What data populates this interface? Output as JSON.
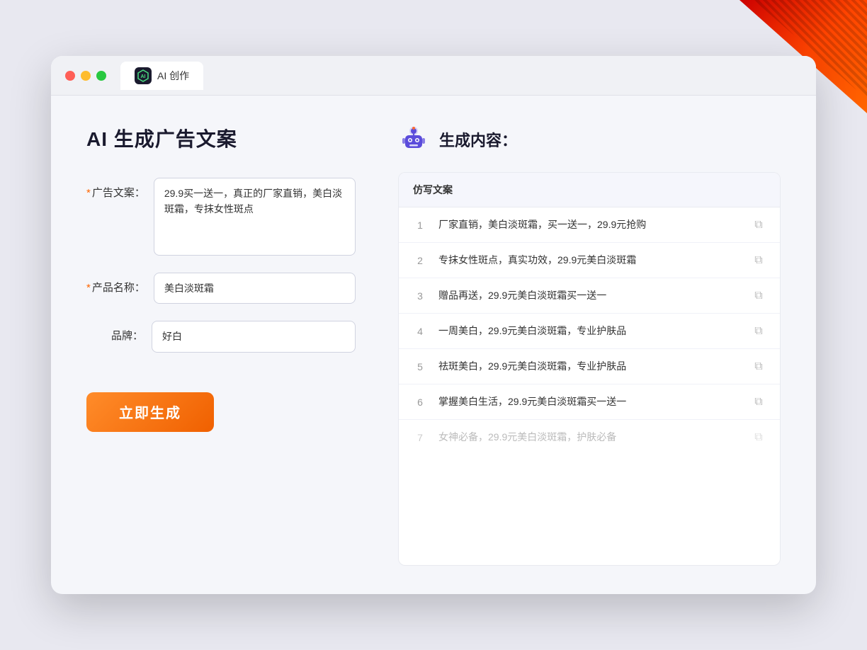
{
  "window": {
    "tab_icon": "AI",
    "tab_label": "AI 创作"
  },
  "left": {
    "title": "AI 生成广告文案",
    "fields": [
      {
        "label": "广告文案：",
        "required": true,
        "name": "ad_copy",
        "type": "textarea",
        "value": "29.9买一送一，真正的厂家直销，美白淡斑霜，专抹女性斑点"
      },
      {
        "label": "产品名称：",
        "required": true,
        "name": "product_name",
        "type": "input",
        "value": "美白淡斑霜"
      },
      {
        "label": "品牌：",
        "required": false,
        "name": "brand",
        "type": "input",
        "value": "好白"
      }
    ],
    "button_label": "立即生成"
  },
  "right": {
    "title": "生成内容：",
    "column_header": "仿写文案",
    "results": [
      {
        "num": 1,
        "text": "厂家直销，美白淡斑霜，买一送一，29.9元抢购",
        "muted": false
      },
      {
        "num": 2,
        "text": "专抹女性斑点，真实功效，29.9元美白淡斑霜",
        "muted": false
      },
      {
        "num": 3,
        "text": "赠品再送，29.9元美白淡斑霜买一送一",
        "muted": false
      },
      {
        "num": 4,
        "text": "一周美白，29.9元美白淡斑霜，专业护肤品",
        "muted": false
      },
      {
        "num": 5,
        "text": "祛斑美白，29.9元美白淡斑霜，专业护肤品",
        "muted": false
      },
      {
        "num": 6,
        "text": "掌握美白生活，29.9元美白淡斑霜买一送一",
        "muted": false
      },
      {
        "num": 7,
        "text": "女神必备，29.9元美白淡斑霜，护肤必备",
        "muted": true
      }
    ]
  },
  "required_star": "* ",
  "colors": {
    "accent": "#f06000",
    "brand": "#5b4cdb"
  }
}
